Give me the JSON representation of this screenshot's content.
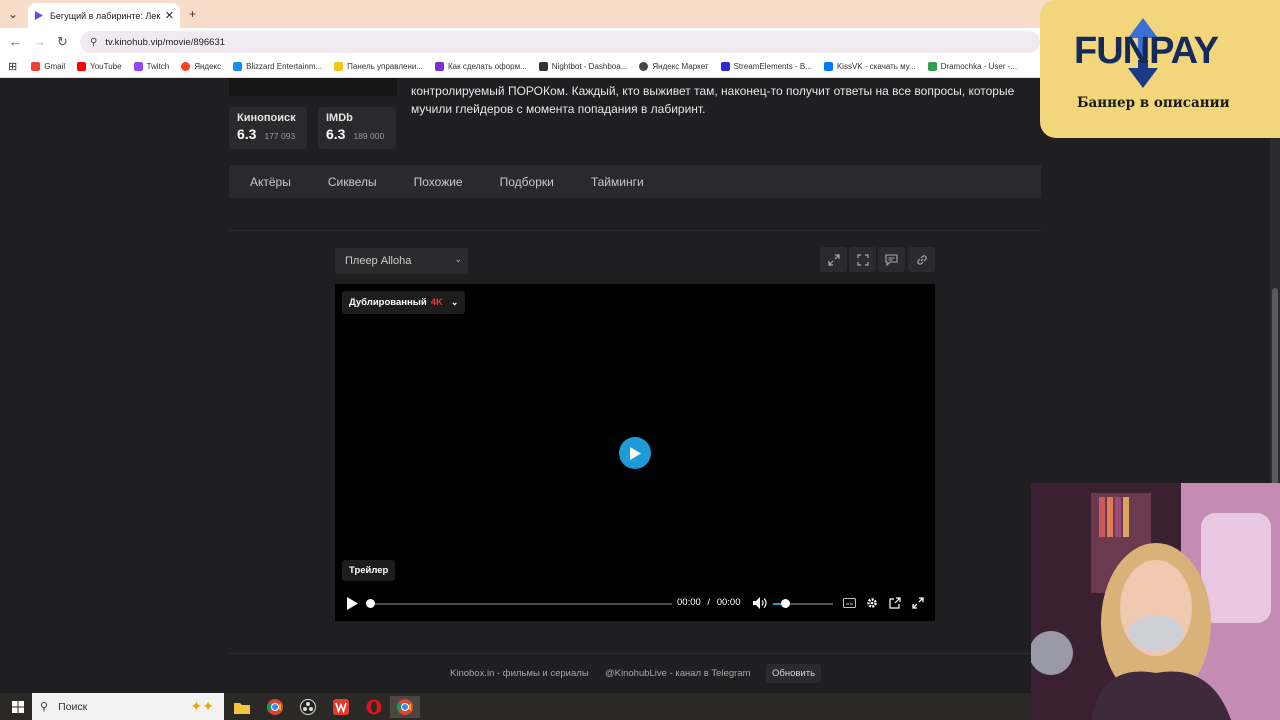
{
  "browser": {
    "tab_title": "Бегущий в лабиринте: Лекарс",
    "url": "tv.kinohub.vip/movie/896631",
    "bookmarks": [
      {
        "label": "Gmail",
        "color": "#ea4335"
      },
      {
        "label": "YouTube",
        "color": "#ff0000"
      },
      {
        "label": "Twitch",
        "color": "#9146ff"
      },
      {
        "label": "Яндекс",
        "color": "#fc3f1d"
      },
      {
        "label": "Blizzard Entertainm...",
        "color": "#148eff"
      },
      {
        "label": "Панель управлени...",
        "color": "#f5c518"
      },
      {
        "label": "Как сделать оформ...",
        "color": "#7b2fd0"
      },
      {
        "label": "Nightbot - Dashboa...",
        "color": "#333333"
      },
      {
        "label": "Яндекс Маркет",
        "color": "#444444"
      },
      {
        "label": "StreamElements - B...",
        "color": "#2b2bd6"
      },
      {
        "label": "KissVK - скачать му...",
        "color": "#0077ff"
      },
      {
        "label": "Dramochka - User -...",
        "color": "#2e9e4f"
      }
    ]
  },
  "movie": {
    "description": "контролируемый ПОРОКом. Каждый, кто выживет там, наконец-то получит ответы на все вопросы, которые мучили глейдеров с момента попадания в лабиринт.",
    "ratings": [
      {
        "name": "Кинопоиск",
        "value": "6.3",
        "count": "177 093"
      },
      {
        "name": "IMDb",
        "value": "6.3",
        "count": "189 000"
      }
    ],
    "tabs": [
      "Актёры",
      "Сиквелы",
      "Похожие",
      "Подборки",
      "Тайминги"
    ]
  },
  "player": {
    "selector_label": "Плеер Alloha",
    "dub_label": "Дублированный",
    "quality": "4K",
    "trailer_label": "Трейлер",
    "time_current": "00:00",
    "time_sep": "/",
    "time_total": "00:00",
    "progress": 0,
    "volume": 0.2
  },
  "footer": {
    "site": "Kinobox.in - фильмы и сериалы",
    "telegram": "@KinohubLive - канал в Telegram",
    "refresh": "Обновить"
  },
  "overlay": {
    "brand": "FUNPAY",
    "banner": "Баннер в описании"
  },
  "taskbar": {
    "search_placeholder": "Поиск"
  },
  "colors": {
    "accent": "#1e9bd7",
    "quality_red": "#e53935",
    "page_bg": "#1f1f21"
  }
}
